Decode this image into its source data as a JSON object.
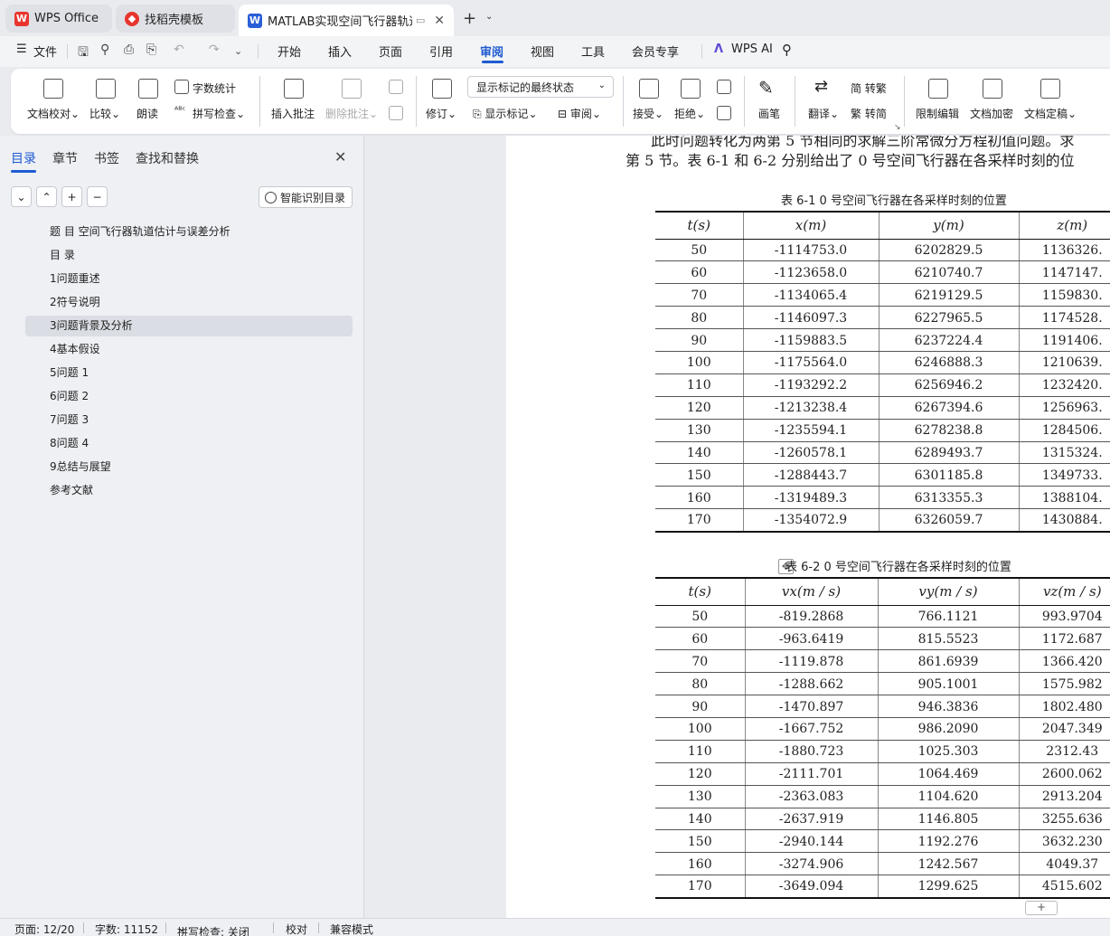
{
  "tabs": [
    {
      "label": "WPS Office",
      "icon": "wps-logo-icon"
    },
    {
      "label": "找稻壳模板",
      "icon": "docer-icon"
    },
    {
      "label": "MATLAB实现空间飞行器轨道估计",
      "icon": "writer-doc-icon",
      "active": true
    }
  ],
  "menubar": {
    "file": "文件",
    "items": [
      "开始",
      "插入",
      "页面",
      "引用",
      "审阅",
      "视图",
      "工具",
      "会员专享"
    ],
    "active": "审阅",
    "ai": "WPS AI"
  },
  "ribbon": {
    "proofread": "文档校对",
    "compare": "比较",
    "read_aloud": "朗读",
    "word_count": "字数统计",
    "spell_check": "拼写检查",
    "insert_comment": "插入批注",
    "delete_comment": "删除批注",
    "track_changes": "修订",
    "display_mode": "显示标记的最终状态",
    "show_markup": "显示标记",
    "review": "审阅",
    "accept": "接受",
    "reject": "拒绝",
    "pen": "画笔",
    "translate": "翻译",
    "to_traditional": "简 转繁",
    "to_simplified": "繁 转简",
    "restrict_editing": "限制编辑",
    "encrypt": "文档加密",
    "finalize": "文档定稿"
  },
  "sidebar": {
    "tabs": [
      "目录",
      "章节",
      "书签",
      "查找和替换"
    ],
    "active_tab": "目录",
    "smart_toc": "智能识别目录",
    "toc": [
      "题 目 空间飞行器轨道估计与误差分析",
      "目 录",
      "1问题重述",
      "2符号说明",
      "3问题背景及分析",
      "4基本假设",
      "5问题 1",
      "6问题 2",
      "7问题 3",
      "8问题 4",
      "9总结与展望",
      "参考文献"
    ],
    "selected_index": 4
  },
  "document": {
    "line1": "此时问题转化为两第 5 节相同的求解三阶常微分方程初值问题。求",
    "line2": "第 5 节。表 6-1 和 6-2 分别给出了 0 号空间飞行器在各采样时刻的位",
    "table1": {
      "caption": "表 6-1   0 号空间飞行器在各采样时刻的位置",
      "headers": [
        "t(s)",
        "x(m)",
        "y(m)",
        "z(m)"
      ],
      "rows": [
        [
          "50",
          "-1114753.0",
          "6202829.5",
          "1136326."
        ],
        [
          "60",
          "-1123658.0",
          "6210740.7",
          "1147147."
        ],
        [
          "70",
          "-1134065.4",
          "6219129.5",
          "1159830."
        ],
        [
          "80",
          "-1146097.3",
          "6227965.5",
          "1174528."
        ],
        [
          "90",
          "-1159883.5",
          "6237224.4",
          "1191406."
        ],
        [
          "100",
          "-1175564.0",
          "6246888.3",
          "1210639."
        ],
        [
          "110",
          "-1193292.2",
          "6256946.2",
          "1232420."
        ],
        [
          "120",
          "-1213238.4",
          "6267394.6",
          "1256963."
        ],
        [
          "130",
          "-1235594.1",
          "6278238.8",
          "1284506."
        ],
        [
          "140",
          "-1260578.1",
          "6289493.7",
          "1315324."
        ],
        [
          "150",
          "-1288443.7",
          "6301185.8",
          "1349733."
        ],
        [
          "160",
          "-1319489.3",
          "6313355.3",
          "1388104."
        ],
        [
          "170",
          "-1354072.9",
          "6326059.7",
          "1430884."
        ]
      ]
    },
    "table2": {
      "caption": "表  6-2 0 号空间飞行器在各采样时刻的位置",
      "headers": [
        "t(s)",
        "vx(m / s)",
        "vy(m / s)",
        "vz(m / s)"
      ],
      "rows": [
        [
          "50",
          "-819.2868",
          "766.1121",
          "993.9704"
        ],
        [
          "60",
          "-963.6419",
          "815.5523",
          "1172.687"
        ],
        [
          "70",
          "-1119.878",
          "861.6939",
          "1366.420"
        ],
        [
          "80",
          "-1288.662",
          "905.1001",
          "1575.982"
        ],
        [
          "90",
          "-1470.897",
          "946.3836",
          "1802.480"
        ],
        [
          "100",
          "-1667.752",
          "986.2090",
          "2047.349"
        ],
        [
          "110",
          "-1880.723",
          "1025.303",
          "2312.43"
        ],
        [
          "120",
          "-2111.701",
          "1064.469",
          "2600.062"
        ],
        [
          "130",
          "-2363.083",
          "1104.620",
          "2913.204"
        ],
        [
          "140",
          "-2637.919",
          "1146.805",
          "3255.636"
        ],
        [
          "150",
          "-2940.144",
          "1192.276",
          "3632.230"
        ],
        [
          "160",
          "-3274.906",
          "1242.567",
          "4049.37"
        ],
        [
          "170",
          "-3649.094",
          "1299.625",
          "4515.602"
        ]
      ]
    }
  },
  "status": {
    "page": "页面: 12/20",
    "words": "字数: 11152",
    "spell": "拼写检查: 关闭",
    "proof": "校对",
    "compat": "兼容模式"
  },
  "colors": {
    "accent": "#1f5ad1",
    "wps_red": "#e8352e"
  }
}
